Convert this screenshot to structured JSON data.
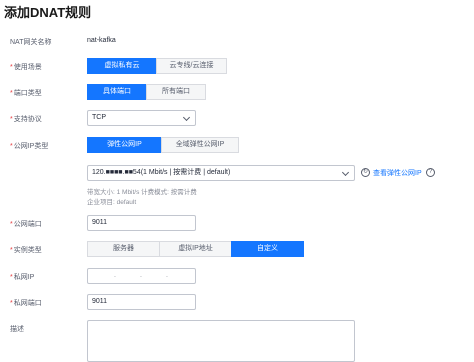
{
  "page": {
    "title": "添加DNAT规则"
  },
  "nat_gateway": {
    "label": "NAT网关名称",
    "value": "nat-kafka"
  },
  "usage_scenario": {
    "label": "使用场景",
    "options": [
      "虚拟私有云",
      "云专线/云连接"
    ],
    "selected": "虚拟私有云"
  },
  "port_type": {
    "label": "端口类型",
    "options": [
      "具体端口",
      "所有端口"
    ],
    "selected": "具体端口"
  },
  "protocol": {
    "label": "支持协议",
    "value": "TCP"
  },
  "eip_type": {
    "label": "公网IP类型",
    "options": [
      "弹性公网IP",
      "全域弹性公网IP"
    ],
    "selected": "弹性公网IP"
  },
  "eip": {
    "value": "120.■■■■.■■54(1 Mbit/s | 按需计费 | default)",
    "view_link": "查看弹性公网IP",
    "hint_bandwidth": "带宽大小: 1 Mbit/s 计费模式: 按需计费",
    "hint_project": "企业项目: default"
  },
  "public_port": {
    "label": "公网端口",
    "value": "9011"
  },
  "instance_type": {
    "label": "实例类型",
    "options": [
      "服务器",
      "虚拟IP地址",
      "自定义"
    ],
    "selected": "自定义"
  },
  "private_ip": {
    "label": "私网IP",
    "separator": "."
  },
  "private_port": {
    "label": "私网端口",
    "value": "9011"
  },
  "description": {
    "label": "描述"
  },
  "icons": {
    "refresh": "refresh-icon",
    "help": "help-icon",
    "dropdown": "chevron-down-icon"
  },
  "colors": {
    "accent": "#1476ff",
    "required": "#e4393c"
  }
}
